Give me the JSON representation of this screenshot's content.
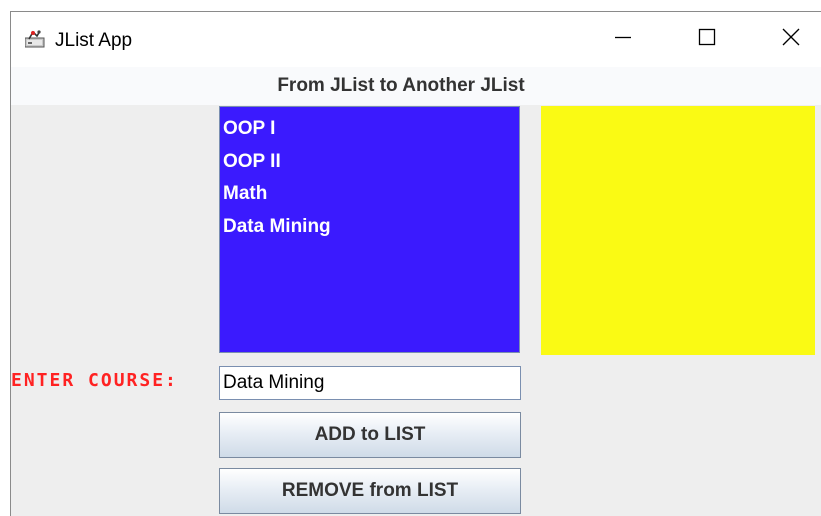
{
  "window": {
    "title": "JList App",
    "icon": "java-app-icon",
    "controls": {
      "minimize": "minimize-icon",
      "maximize": "maximize-icon",
      "close": "close-icon"
    }
  },
  "header": {
    "title": "From JList to Another JList"
  },
  "source_list": {
    "background": "#3b1afe",
    "items": [
      "OOP I",
      "OOP II",
      "Math",
      "Data Mining"
    ]
  },
  "target_list": {
    "background": "#fafa14",
    "items": []
  },
  "form": {
    "course_label": "ENTER COURSE:",
    "course_value": "Data Mining",
    "add_label": "ADD to LIST",
    "remove_label": "REMOVE from LIST"
  },
  "colors": {
    "label": "#ff2222"
  }
}
